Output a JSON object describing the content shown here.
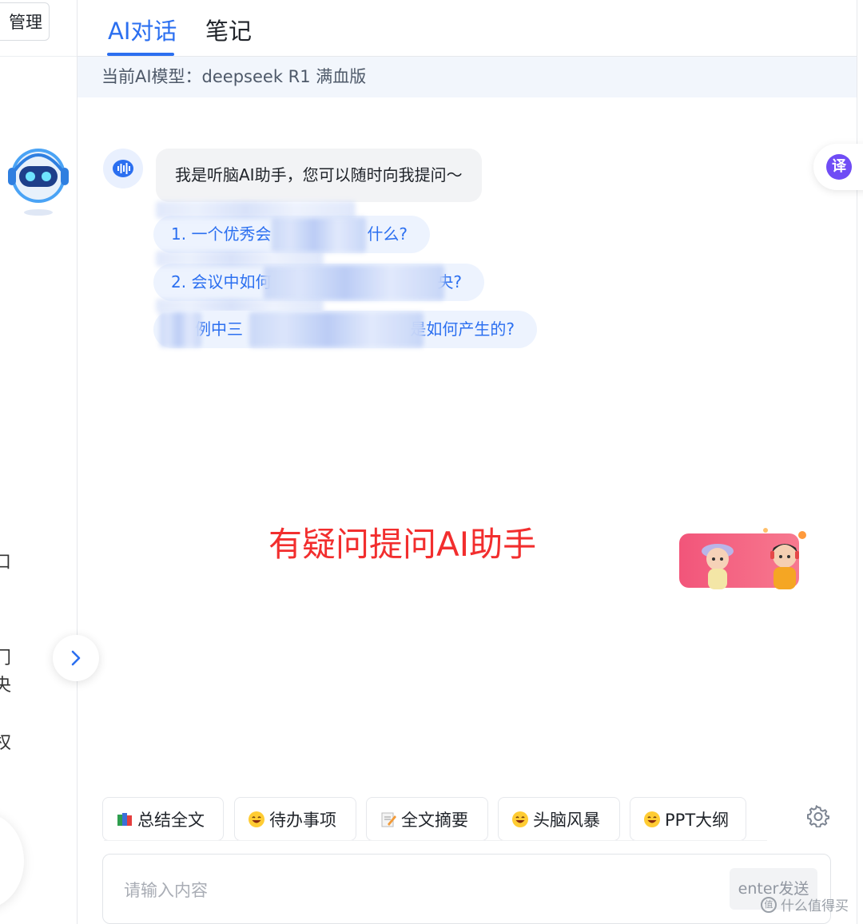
{
  "sidebar": {
    "manage_label": "管理",
    "partial_glyphs": [
      "口",
      "门",
      "央",
      "权"
    ]
  },
  "tabs": [
    {
      "label": "AI对话",
      "active": true
    },
    {
      "label": "笔记",
      "active": false
    }
  ],
  "model_bar": {
    "text": "当前AI模型：deepseek R1 满血版"
  },
  "chat": {
    "greeting": "我是听脑AI助手，您可以随时向我提问～",
    "suggestions": [
      {
        "visible_start": "1. 一个优秀会",
        "visible_end": "什么?"
      },
      {
        "visible_start": "2. 会议中如何",
        "visible_end": "央?"
      },
      {
        "visible_start": "例中三",
        "visible_end": "是如何产生的?"
      }
    ]
  },
  "annotation": {
    "text": "有疑问提问AI助手",
    "color": "#f22e2e"
  },
  "translate": {
    "glyph": "译"
  },
  "quick_actions": [
    {
      "label": "总结全文",
      "icon": "books-icon"
    },
    {
      "label": "待办事项",
      "icon": "smile-emoji-icon"
    },
    {
      "label": "全文摘要",
      "icon": "memo-icon"
    },
    {
      "label": "头脑风暴",
      "icon": "smile-emoji-icon"
    },
    {
      "label": "PPT大纲",
      "icon": "smile-emoji-icon"
    }
  ],
  "input": {
    "placeholder": "请输入内容",
    "value": "",
    "send_label": "enter发送"
  },
  "watermark": {
    "text": "什么值得买",
    "glyph": "值"
  },
  "colors": {
    "accent": "#2b6ff0",
    "suggestion_bg": "#edf3fe",
    "bubble_bg": "#f2f3f5",
    "annotation": "#f22e2e"
  }
}
